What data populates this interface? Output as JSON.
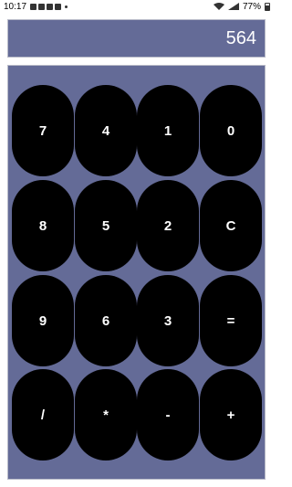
{
  "status_bar": {
    "time": "10:17",
    "battery": "77%"
  },
  "display": {
    "value": "564"
  },
  "keys": {
    "k7": "7",
    "k4": "4",
    "k1": "1",
    "k0": "0",
    "k8": "8",
    "k5": "5",
    "k2": "2",
    "clear": "C",
    "k9": "9",
    "k6": "6",
    "k3": "3",
    "equals": "=",
    "divide": "/",
    "multiply": "*",
    "minus": "-",
    "plus": "+"
  },
  "colors": {
    "panel": "#646b97",
    "key": "#000000",
    "key_text": "#ffffff"
  }
}
